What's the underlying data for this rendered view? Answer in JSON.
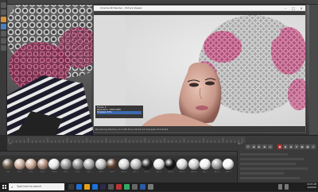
{
  "render_window": {
    "title": "Cinema 4D Render - Picture Viewer",
    "status_text": "Rendering  Memory 2.0 GB  Time 00:01:23  Samples 512/1024",
    "icons": {
      "close": "close-icon",
      "minimize": "minimize-icon",
      "maximize": "maximize-icon"
    }
  },
  "stats_overlay": {
    "line1": "Frame: 0",
    "line2": "Resolution: 1920x1080",
    "line3": "Progress: 67%"
  },
  "timeline": {
    "frame_start": "0 F",
    "frame_end": "90 F"
  },
  "material_manager": {
    "materials": [
      {
        "label": "Mat",
        "color": "#6a5a4a"
      },
      {
        "label": "Mat.1",
        "color": "#c9a99a"
      },
      {
        "label": "Mat.2",
        "color": "#caa893"
      },
      {
        "label": "Mat.3",
        "color": "#b08a7a"
      },
      {
        "label": "Mat.4",
        "color": "#e8e8e8"
      },
      {
        "label": "Mat.5",
        "color": "#999999"
      },
      {
        "label": "Mat.6",
        "color": "#8a8a8a"
      },
      {
        "label": "Mat.7",
        "color": "#aaaaaa"
      },
      {
        "label": "Mat.8",
        "color": "#c0c0c0"
      },
      {
        "label": "Mat.9",
        "color": "#5c3c2c"
      },
      {
        "label": "Mat.10",
        "color": "#d7d7d7"
      },
      {
        "label": "Mat.11",
        "color": "#bdbdbd"
      },
      {
        "label": "Mat.12",
        "color": "#222222"
      },
      {
        "label": "Mat.13",
        "color": "#e6e6e6"
      },
      {
        "label": "Mat.14",
        "color": "#111111"
      },
      {
        "label": "Mat.15",
        "color": "#dcdcdc"
      },
      {
        "label": "Mat.16",
        "color": "#cfcfcf"
      },
      {
        "label": "Mat.17",
        "color": "#f0f0f0"
      },
      {
        "label": "Mat.18",
        "color": "#9e9e9e"
      },
      {
        "label": "Mat.19",
        "color": "#f5f5f5"
      }
    ]
  },
  "taskbar": {
    "search_placeholder": "Type here to search",
    "time": "10:25 AM",
    "date": "4/9/2018"
  },
  "colors": {
    "accent": "#3d6ab3",
    "taskbar": "#1f1f1f",
    "pink_hair": "#d45a8a"
  }
}
